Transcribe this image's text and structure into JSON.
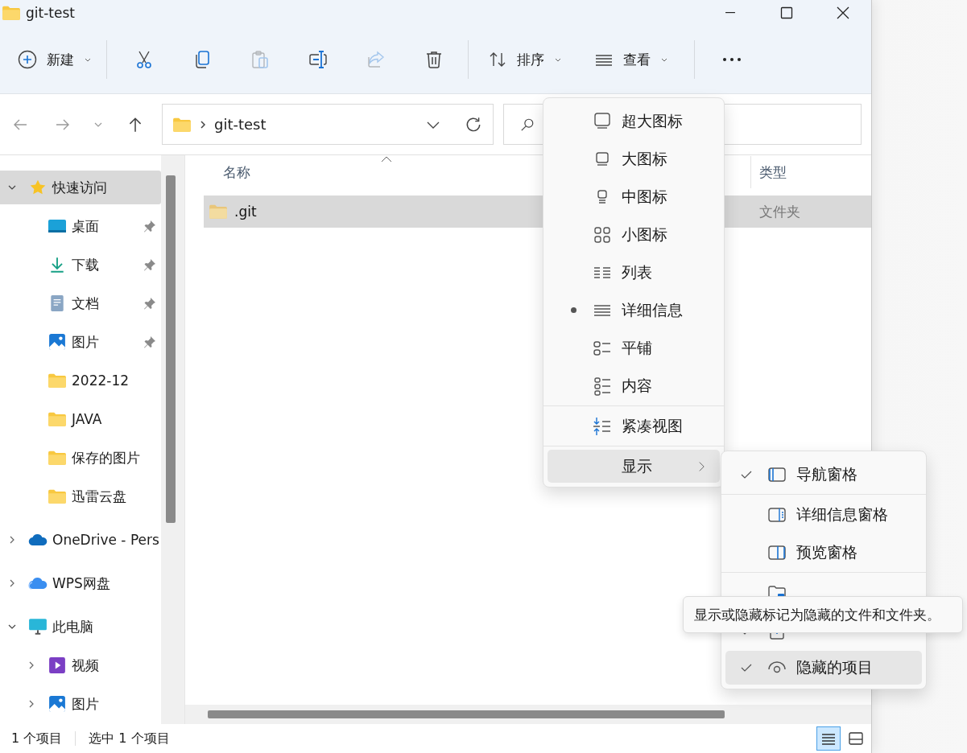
{
  "window": {
    "title": "git-test"
  },
  "toolbar": {
    "new_button": {
      "label": "新建"
    },
    "actions": [
      {
        "kind": "cut",
        "disabled": false
      },
      {
        "kind": "copy",
        "disabled": false
      },
      {
        "kind": "paste",
        "disabled": true
      },
      {
        "kind": "rename",
        "disabled": false
      },
      {
        "kind": "share",
        "disabled": true
      },
      {
        "kind": "delete",
        "disabled": false
      }
    ],
    "sort_button": {
      "label": "排序"
    },
    "view_button": {
      "label": "查看"
    }
  },
  "address_bar": {
    "path": [
      "git-test"
    ]
  },
  "sidebar": {
    "items": [
      {
        "label": "快速访问",
        "kind": "star",
        "expanded": true,
        "selected": true,
        "children": [
          {
            "label": "桌面",
            "kind": "desktop",
            "pinned": true,
            "selected": false
          },
          {
            "label": "下载",
            "kind": "download",
            "pinned": true,
            "selected": false
          },
          {
            "label": "文档",
            "kind": "document",
            "pinned": true,
            "selected": false
          },
          {
            "label": "图片",
            "kind": "pictures",
            "pinned": true,
            "selected": false
          },
          {
            "label": "2022-12",
            "kind": "folder",
            "pinned": false,
            "selected": false
          },
          {
            "label": "JAVA",
            "kind": "folder",
            "pinned": false,
            "selected": false
          },
          {
            "label": "保存的图片",
            "kind": "folder",
            "pinned": false,
            "selected": false
          },
          {
            "label": "迅雷云盘",
            "kind": "folder",
            "pinned": false,
            "selected": false
          }
        ]
      },
      {
        "label": "OneDrive - Pers",
        "kind": "cloud",
        "expanded": false,
        "selected": false
      },
      {
        "label": "WPS网盘",
        "kind": "cloud2",
        "expanded": false,
        "selected": false
      },
      {
        "label": "此电脑",
        "kind": "pc",
        "expanded": true,
        "selected": false,
        "children": [
          {
            "label": "视频",
            "kind": "video",
            "expanded": false,
            "selected": false
          },
          {
            "label": "图片",
            "kind": "pictures",
            "expanded": false,
            "selected": false
          }
        ]
      }
    ]
  },
  "table": {
    "columns": [
      "名称",
      "类型"
    ],
    "rows": [
      {
        "name": ".git",
        "type": "文件夹",
        "selected": true
      }
    ]
  },
  "view_menu": {
    "items": [
      {
        "kind": "item",
        "label": "超大图标",
        "selected": false
      },
      {
        "kind": "item",
        "label": "大图标",
        "selected": false
      },
      {
        "kind": "item",
        "label": "中图标",
        "selected": false
      },
      {
        "kind": "item",
        "label": "小图标",
        "selected": false
      },
      {
        "kind": "item",
        "label": "列表",
        "selected": false
      },
      {
        "kind": "item",
        "label": "详细信息",
        "selected": true
      },
      {
        "kind": "item",
        "label": "平铺",
        "selected": false
      },
      {
        "kind": "item",
        "label": "内容",
        "selected": false
      },
      {
        "kind": "separator"
      },
      {
        "kind": "item",
        "label": "紧凑视图",
        "selected": false
      },
      {
        "kind": "separator"
      },
      {
        "kind": "submenu",
        "label": "显示",
        "selected": true
      }
    ]
  },
  "show_submenu": {
    "items": [
      {
        "kind": "item",
        "label": "导航窗格",
        "checked": true,
        "selected": false
      },
      {
        "kind": "separator"
      },
      {
        "kind": "item",
        "label": "详细信息窗格",
        "checked": false,
        "selected": false
      },
      {
        "kind": "item",
        "label": "预览窗格",
        "checked": false,
        "selected": false
      },
      {
        "kind": "separator"
      },
      {
        "kind": "item",
        "checked": false,
        "selected": false
      },
      {
        "kind": "item",
        "checked": true,
        "selected": false
      },
      {
        "kind": "item",
        "label": "隐藏的项目",
        "checked": true,
        "selected": true
      }
    ]
  },
  "tooltip": {
    "text": "显示或隐藏标记为隐藏的文件和文件夹。"
  },
  "status_bar": {
    "item_count": "1 个项目",
    "selection": "选中 1 个项目",
    "view_toggles": [
      {
        "kind": "details",
        "selected": true
      },
      {
        "kind": "thumbnails",
        "selected": false
      }
    ]
  }
}
